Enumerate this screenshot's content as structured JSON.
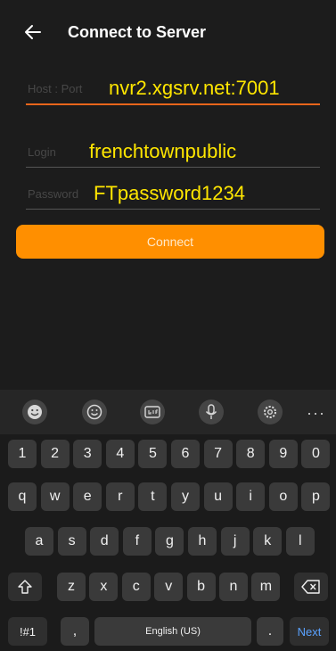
{
  "header": {
    "title": "Connect to Server"
  },
  "form": {
    "host_placeholder": "Host : Port",
    "host_value": "nvr2.xgsrv.net:7001",
    "login_placeholder": "Login",
    "login_value": "frenchtownpublic",
    "password_placeholder": "Password",
    "password_value": "FTpassword1234",
    "connect_label": "Connect"
  },
  "keyboard": {
    "toolbar_more": "···",
    "numbers": [
      "1",
      "2",
      "3",
      "4",
      "5",
      "6",
      "7",
      "8",
      "9",
      "0"
    ],
    "row1": [
      "q",
      "w",
      "e",
      "r",
      "t",
      "y",
      "u",
      "i",
      "o",
      "p"
    ],
    "row2": [
      "a",
      "s",
      "d",
      "f",
      "g",
      "h",
      "j",
      "k",
      "l"
    ],
    "row3": [
      "z",
      "x",
      "c",
      "v",
      "b",
      "n",
      "m"
    ],
    "symbols_key": "!#1",
    "comma_key": ",",
    "space_label": "English (US)",
    "period_key": ".",
    "action_label": "Next"
  }
}
